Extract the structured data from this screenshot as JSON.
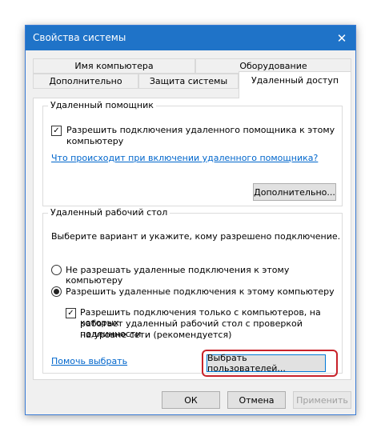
{
  "window": {
    "title": "Свойства системы",
    "close_icon": "close-icon"
  },
  "tabs": {
    "row_top": [
      "Имя компьютера",
      "Оборудование"
    ],
    "row_bottom": [
      "Дополнительно",
      "Защита системы",
      "Удаленный доступ"
    ],
    "active": "Удаленный доступ"
  },
  "remote_assistance": {
    "group_label": "Удаленный помощник",
    "allow_checkbox_checked": true,
    "allow_label_line1": "Разрешить подключения удаленного помощника к этому",
    "allow_label_line2": "компьютеру",
    "help_link": "Что происходит при включении удаленного помощника?",
    "advanced_button": "Дополнительно..."
  },
  "remote_desktop": {
    "group_label": "Удаленный рабочий стол",
    "instruction": "Выберите вариант и укажите, кому разрешено подключение.",
    "option_deny": "Не разрешать удаленные подключения к этому компьютеру",
    "option_allow": "Разрешить удаленные подключения к этому компьютеру",
    "selected_option": "allow",
    "nla_checkbox_checked": true,
    "nla_line1": "Разрешить подключения только с компьютеров, на которых",
    "nla_line2": "работает удаленный рабочий стол с проверкой подлинности",
    "nla_line3": "на уровне сети (рекомендуется)",
    "help_link": "Помочь выбрать",
    "select_users_button": "Выбрать пользователей..."
  },
  "footer": {
    "ok": "ОК",
    "cancel": "Отмена",
    "apply": "Применить"
  },
  "colors": {
    "titlebar": "#1f73c8",
    "link": "#0066cc",
    "highlight": "#c8222a"
  }
}
